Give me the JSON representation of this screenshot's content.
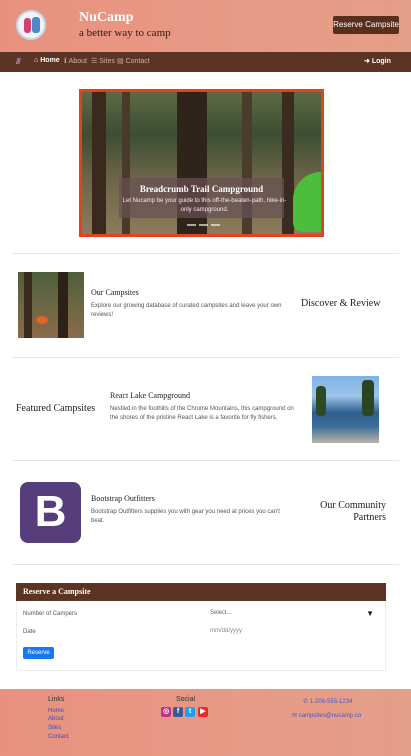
{
  "header": {
    "brand": "NuCamp",
    "tagline": "a better way to camp",
    "reserve_button": "Reserve Campsite"
  },
  "nav": {
    "items": [
      {
        "label": "Home",
        "icon": "home-icon"
      },
      {
        "label": "About",
        "icon": "info-icon"
      },
      {
        "label": "Sites",
        "icon": "list-icon"
      },
      {
        "label": "Contact",
        "icon": "address-card-icon"
      }
    ],
    "login": "Login"
  },
  "carousel": {
    "title": "Breadcrumb Trail Campground",
    "text": "Let Nucamp be your guide to this off-the-beaten-path, hike-in-only campground."
  },
  "sections": [
    {
      "title": "Our Campsites",
      "text": "Explore our growing database of curated campsites and leave your own reviews!",
      "side": "Discover & Review"
    },
    {
      "title": "React Lake Campground",
      "text": "Nestled in the foothills of the Chrome Mountains, this campground on the shores of the pristine React Lake is a favorite for fly fishers.",
      "side": "Featured Campsites"
    },
    {
      "title": "Bootstrap Outfitters",
      "text": "Bootstrap Outfitters supplies you with gear you need at prices you can't beat.",
      "side": "Our Community Partners"
    }
  ],
  "reserve_form": {
    "heading": "Reserve a Campsite",
    "campers_label": "Number of Campers",
    "campers_value": "Select...",
    "date_label": "Date",
    "date_placeholder": "mm/dd/yyyy",
    "submit": "Reserve"
  },
  "footer": {
    "links_heading": "Links",
    "links": [
      "Home",
      "About",
      "Sites",
      "Contact"
    ],
    "social_heading": "Social",
    "social_icons": [
      "instagram-icon",
      "facebook-icon",
      "twitter-icon",
      "youtube-icon"
    ],
    "phone": "1-206-555-1234",
    "email": "campsites@nucamp.co"
  },
  "colors": {
    "header_gradient_start": "#e8917f",
    "nav_bg": "#5c3423",
    "carousel_border": "#e2431e",
    "reserve_button_bg": "#1877f2"
  }
}
